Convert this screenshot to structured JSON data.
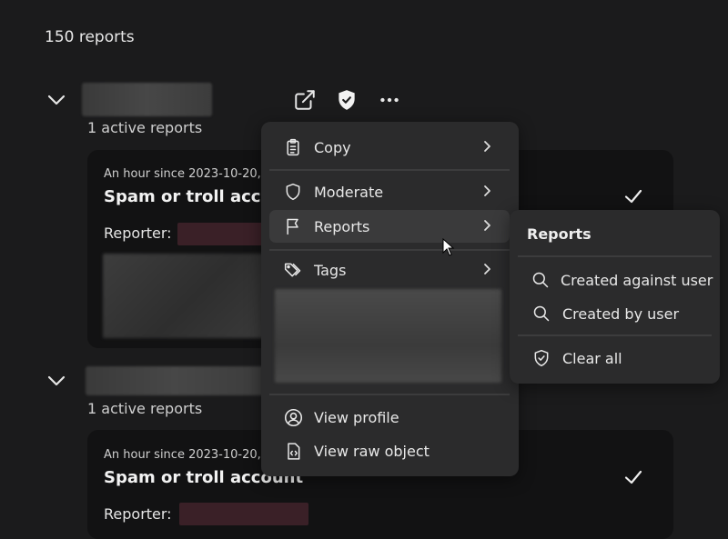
{
  "header": {
    "count": "150 reports"
  },
  "groups": [
    {
      "active": "1 active reports",
      "card": {
        "meta": "An hour since 2023-10-20,",
        "reason": "Spam or troll acco",
        "reporter_label": "Reporter:"
      }
    },
    {
      "active": "1 active reports",
      "card": {
        "meta": "An hour since 2023-10-20,",
        "reason": "Spam or troll account",
        "reporter_label": "Reporter:"
      }
    }
  ],
  "toolbar": {
    "icons": [
      "external-link-icon",
      "shield-check-icon",
      "more-icon"
    ]
  },
  "context_menu": {
    "items": [
      {
        "label": "Copy",
        "icon": "clipboard-icon"
      },
      {
        "label": "Moderate",
        "icon": "shield-icon"
      },
      {
        "label": "Reports",
        "icon": "flag-icon"
      },
      {
        "label": "Tags",
        "icon": "tags-icon"
      },
      {
        "label": "View profile",
        "icon": "user-circle-icon"
      },
      {
        "label": "View raw object",
        "icon": "code-file-icon"
      }
    ]
  },
  "submenu": {
    "title": "Reports",
    "items": [
      {
        "label": "Created against user",
        "icon": "search-icon"
      },
      {
        "label": "Created by user",
        "icon": "search-icon"
      },
      {
        "label": "Clear all",
        "icon": "shield-check-icon"
      }
    ]
  },
  "colors": {
    "background": "#1b1b1c",
    "card": "#121213",
    "menu": "#2b2b2c",
    "hover": "#3a3a3b"
  }
}
